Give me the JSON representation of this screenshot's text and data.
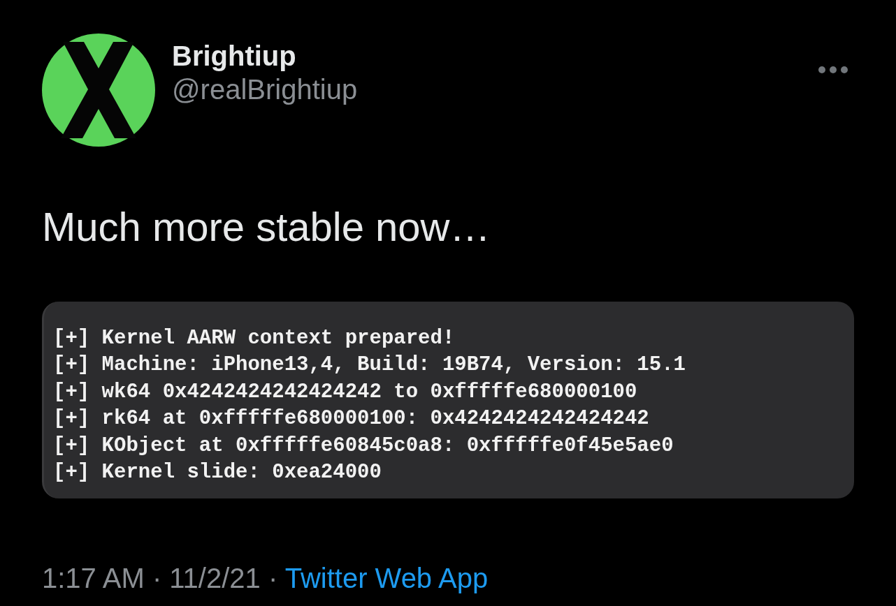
{
  "author": {
    "name": "Brightiup",
    "handle": "@realBrightiup"
  },
  "text": "Much more stable now…",
  "code_lines": [
    "[+] Kernel AARW context prepared!",
    "[+] Machine: iPhone13,4, Build: 19B74, Version: 15.1",
    "[+] wk64 0x4242424242424242 to 0xfffffe680000100",
    "[+] rk64 at 0xfffffe680000100: 0x4242424242424242",
    "[+] KObject at 0xfffffe60845c0a8: 0xfffffe0f45e5ae0",
    "[+] Kernel slide: 0xea24000"
  ],
  "footer": {
    "time": "1:17 AM",
    "separator_1": "·",
    "date": "11/2/21",
    "separator_2": "·",
    "source": "Twitter Web App"
  }
}
